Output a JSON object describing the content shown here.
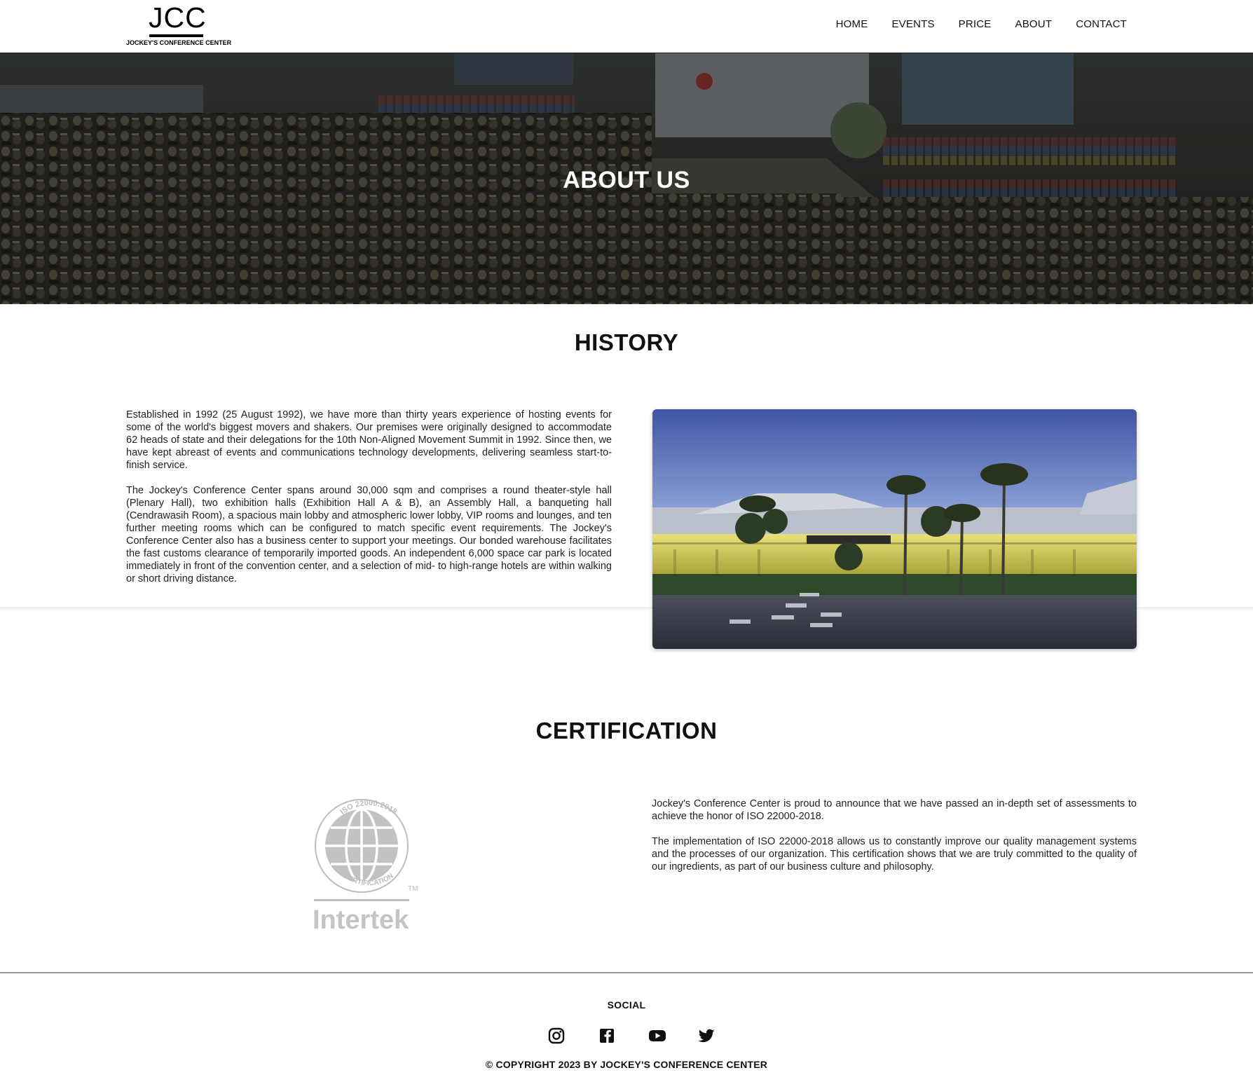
{
  "header": {
    "logo_mark": "JCC",
    "logo_subtitle": "JOCKEY'S CONFERENCE CENTER",
    "nav": [
      "HOME",
      "EVENTS",
      "PRICE",
      "ABOUT",
      "CONTACT"
    ]
  },
  "hero": {
    "title": "ABOUT US"
  },
  "history": {
    "title": "HISTORY",
    "paragraphs": [
      "Established in 1992 (25 August 1992), we have more than thirty years experience of hosting events for some of the world's biggest movers and shakers. Our premises were originally designed to accommodate 62 heads of state and their delegations for the 10th Non-Aligned Movement Summit in 1992. Since then, we have kept abreast of events and communications technology developments, delivering seamless start-to-finish service.",
      "The Jockey's Conference Center spans around 30,000 sqm and comprises a round theater-style hall (Plenary Hall), two exhibition halls (Exhibition Hall A & B), an Assembly Hall, a banqueting hall (Cendrawasih Room), a spacious main lobby and atmospheric lower lobby, VIP rooms and lounges, and ten further meeting rooms which can be configured to match specific event requirements. The Jockey's Conference Center also has a business center to support your meetings. Our bonded warehouse facilitates the fast customs clearance of temporarily imported goods. An independent 6,000 space car park is located immediately in front of the convention center, and a selection of mid- to high-range hotels are within walking or short driving distance."
    ]
  },
  "certification": {
    "title": "CERTIFICATION",
    "logo_ring_text": "ISO 22000:2018",
    "logo_ring_bottom": "CERTIFICATION",
    "logo_brand": "Intertek",
    "logo_tm": "TM",
    "paragraphs": [
      "Jockey's Conference Center is proud to announce that we have passed an in-depth set of assessments to achieve the honor of ISO 22000-2018.",
      "The implementation of ISO 22000-2018 allows us to constantly improve our quality management systems and the processes of our organization. This certification shows that we are truly committed to the quality of our ingredients, as part of our business culture and philosophy."
    ]
  },
  "footer": {
    "social_title": "SOCIAL",
    "social_icons": [
      "instagram-icon",
      "facebook-icon",
      "youtube-icon",
      "twitter-icon"
    ],
    "copyright": "© COPYRIGHT 2023 BY JOCKEY'S CONFERENCE CENTER"
  }
}
